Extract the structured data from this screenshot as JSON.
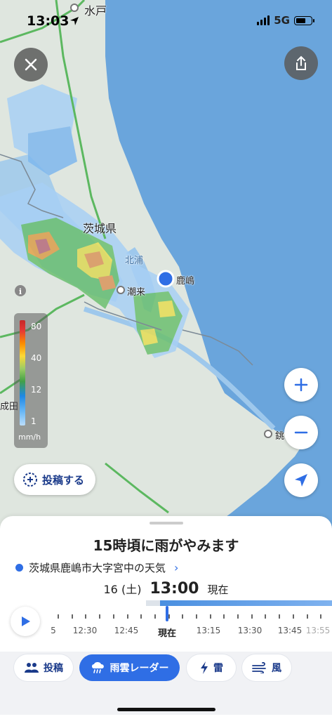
{
  "status": {
    "time": "13:03",
    "network": "5G"
  },
  "map": {
    "labels": {
      "mito": "水戸",
      "ibaraki_pref": "茨城県",
      "kitaura": "北浦",
      "itako": "潮来",
      "kashima": "鹿嶋",
      "choshi": "銚",
      "narita": "成田"
    }
  },
  "legend": {
    "ticks": [
      "80",
      "40",
      "12",
      "1"
    ],
    "unit": "mm/h"
  },
  "post_button": {
    "label": "投稿する"
  },
  "sheet": {
    "headline": "15時頃に雨がやみます",
    "location": "茨城県鹿嶋市大字宮中の天気",
    "date": "16 (土)",
    "time": "13:00",
    "now_tag": "現在",
    "timeline_labels": [
      "5",
      "12:30",
      "12:45",
      "現在",
      "13:15",
      "13:30",
      "13:45",
      "13:55"
    ]
  },
  "tabs": [
    {
      "label": "投稿",
      "icon": "people-icon"
    },
    {
      "label": "雨雲レーダー",
      "icon": "rain-cloud-icon"
    },
    {
      "label": "雷",
      "icon": "lightning-icon"
    },
    {
      "label": "風",
      "icon": "wind-icon"
    }
  ],
  "colors": {
    "accent": "#2f6ee5",
    "sea": "#6aa5dc",
    "land": "#dfe6df"
  }
}
